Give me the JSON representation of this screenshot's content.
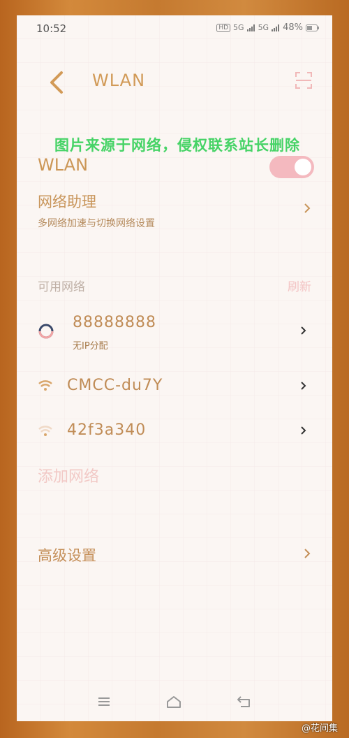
{
  "status_bar": {
    "time": "10:52",
    "chip": "HD",
    "sig1": "5G",
    "sig2": "5G",
    "battery": "48%"
  },
  "header": {
    "title": "WLAN"
  },
  "watermark": "图片来源于网络，侵权联系站长删除",
  "wlan": {
    "label": "WLAN",
    "enabled": true
  },
  "assistant": {
    "title": "网络助理",
    "subtitle": "多网络加速与切换网络设置"
  },
  "available": {
    "section_label": "可用网络",
    "refresh_label": "刷新",
    "networks": [
      {
        "ssid": "88888888",
        "status": "无IP分配",
        "icon": "connecting-ring-icon"
      },
      {
        "ssid": "CMCC-du7Y",
        "status": "",
        "icon": "wifi-icon"
      },
      {
        "ssid": "42f3a340",
        "status": "",
        "icon": "wifi-weak-icon"
      }
    ]
  },
  "add_network_label": "添加网络",
  "advanced_label": "高级设置",
  "credit": "@花间集",
  "colors": {
    "accent": "#d19a57",
    "toggle": "#f4b9bf",
    "watermark": "#46d366"
  }
}
